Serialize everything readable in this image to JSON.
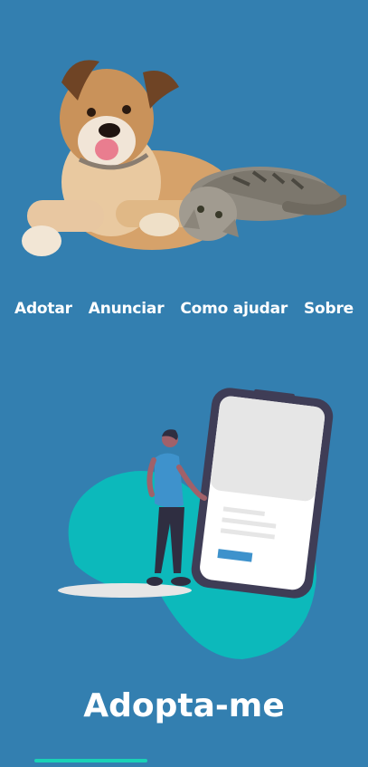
{
  "hero": {
    "image": "dog-and-cat-photo"
  },
  "nav": {
    "items": [
      {
        "label": "Adotar"
      },
      {
        "label": "Anunciar"
      },
      {
        "label": "Como ajudar"
      },
      {
        "label": "Sobre"
      }
    ]
  },
  "illustration": {
    "image": "person-with-phone-illustration"
  },
  "brand": {
    "title": "Adopta-me"
  },
  "colors": {
    "background": "#337fb0",
    "accent": "#1ad2b6",
    "blob": "#0cb9bb",
    "phone_frame": "#3f3d56"
  }
}
